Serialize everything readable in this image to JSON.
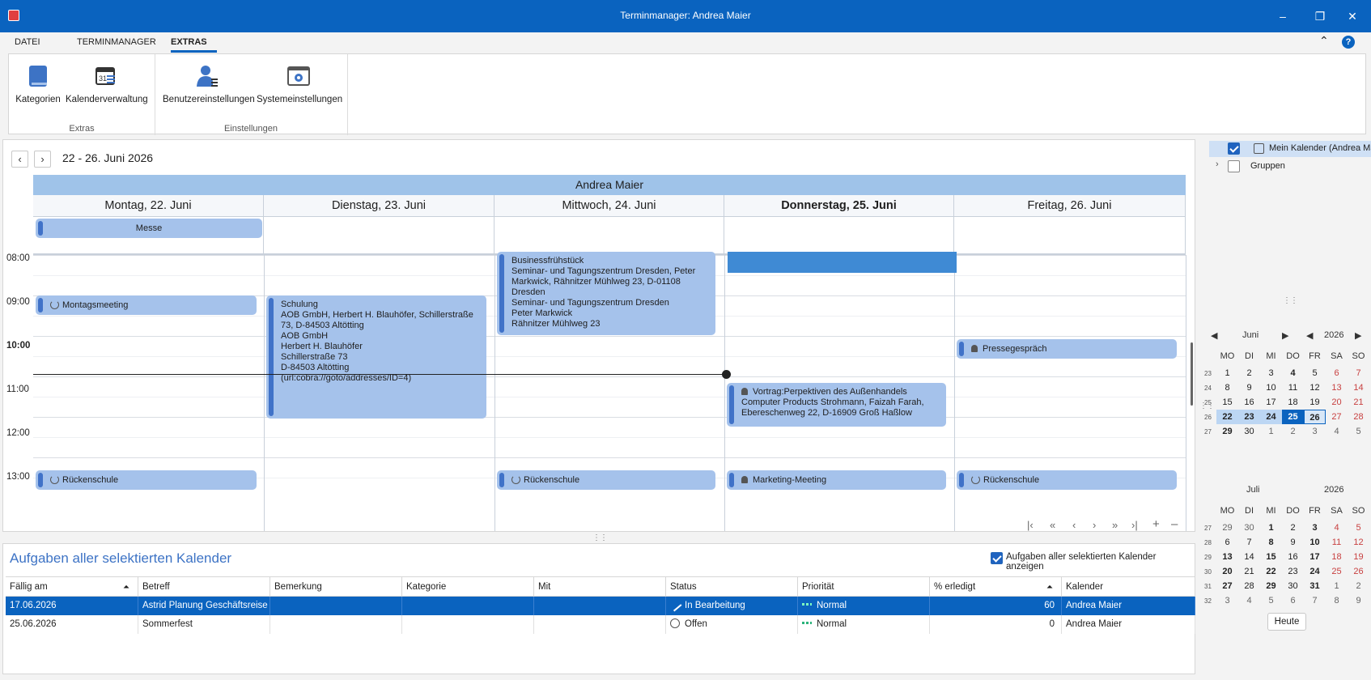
{
  "window": {
    "title": "Terminmanager: Andrea Maier",
    "min": "–",
    "max": "❐",
    "close": "✕"
  },
  "ribbon": {
    "tabs": [
      "DATEI",
      "TERMINMANAGER",
      "EXTRAS"
    ],
    "buttons": [
      "Kategorien",
      "Kalenderverwaltung",
      "Benutzereinstellungen",
      "Systemeinstellungen"
    ],
    "groups": [
      "Extras",
      "Einstellungen"
    ],
    "collapse": "⌃",
    "help": "?"
  },
  "calendar": {
    "prev": "‹",
    "next": "›",
    "range": "22 - 26. Juni 2026",
    "resource": "Andrea Maier",
    "days": [
      "Montag, 22. Juni",
      "Dienstag, 23. Juni",
      "Mittwoch, 24. Juni",
      "Donnerstag, 25. Juni",
      "Freitag, 26. Juni"
    ],
    "times": [
      "08:00",
      "09:00",
      "10:00",
      "11:00",
      "12:00",
      "13:00"
    ],
    "allday": {
      "title": "Messe"
    },
    "appointments": {
      "montag1": "Montagsmeeting",
      "schulung": [
        "Schulung",
        "AOB GmbH, Herbert H. Blauhöfer, Schillerstraße",
        "73, D-84503 Altötting",
        "AOB GmbH",
        "Herbert H. Blauhöfer",
        "Schillerstraße 73",
        "D-84503 Altötting",
        "(url:cobra://goto/addresses/ID=4)"
      ],
      "business": [
        "Businessfrühstück",
        "Seminar- und Tagungszentrum Dresden, Peter",
        "Markwick, Rähnitzer Mühlweg 23, D-01108",
        "Dresden",
        "Seminar- und Tagungszentrum Dresden",
        "Peter Markwick",
        "Rähnitzer Mühlweg 23"
      ],
      "presse": "Pressegespräch",
      "vortrag": [
        "Vortrag:Perpektiven des Außenhandels",
        "Computer Products Strohmann, Faizah Farah,",
        "Ebereschenweg 22, D-16909 Groß Haßlow"
      ],
      "ruecken": "Rückenschule",
      "marketing": "Marketing-Meeting"
    },
    "pager": [
      "|‹",
      "«",
      "‹",
      "›",
      "»",
      "›|",
      "+",
      "–"
    ]
  },
  "tasks": {
    "title": "Aufgaben aller selektierten Kalender",
    "show_label": "Aufgaben aller selektierten Kalender anzeigen",
    "columns": [
      "Fällig am",
      "Betreff",
      "Bemerkung",
      "Kategorie",
      "Mit",
      "Status",
      "Priorität",
      "% erledigt",
      "Kalender"
    ],
    "rows": [
      [
        "17.06.2026",
        "Astrid Planung Geschäftsreise",
        "",
        "",
        "",
        "In Bearbeitung",
        "Normal",
        "60",
        "Andrea Maier"
      ],
      [
        "25.06.2026",
        "Sommerfest",
        "",
        "",
        "",
        "Offen",
        "Normal",
        "0",
        "Andrea Maier"
      ]
    ]
  },
  "sidebar": {
    "calendars": [
      {
        "label": "Mein Kalender (Andrea Maier)",
        "checked": true
      },
      {
        "label": "Gruppen",
        "checked": false
      }
    ],
    "dow": [
      "MO",
      "DI",
      "MI",
      "DO",
      "FR",
      "SA",
      "SO"
    ],
    "june": {
      "month": "Juni",
      "year": "2026",
      "weeks": [
        "23",
        "24",
        "25",
        "26",
        "27"
      ]
    },
    "july": {
      "month": "Juli",
      "year": "2026",
      "weeks": [
        "27",
        "28",
        "29",
        "30",
        "31",
        "32"
      ]
    },
    "today": "Heute"
  },
  "colors": {
    "accent": "#0a63bf",
    "appointment": "#a5c2eb"
  }
}
